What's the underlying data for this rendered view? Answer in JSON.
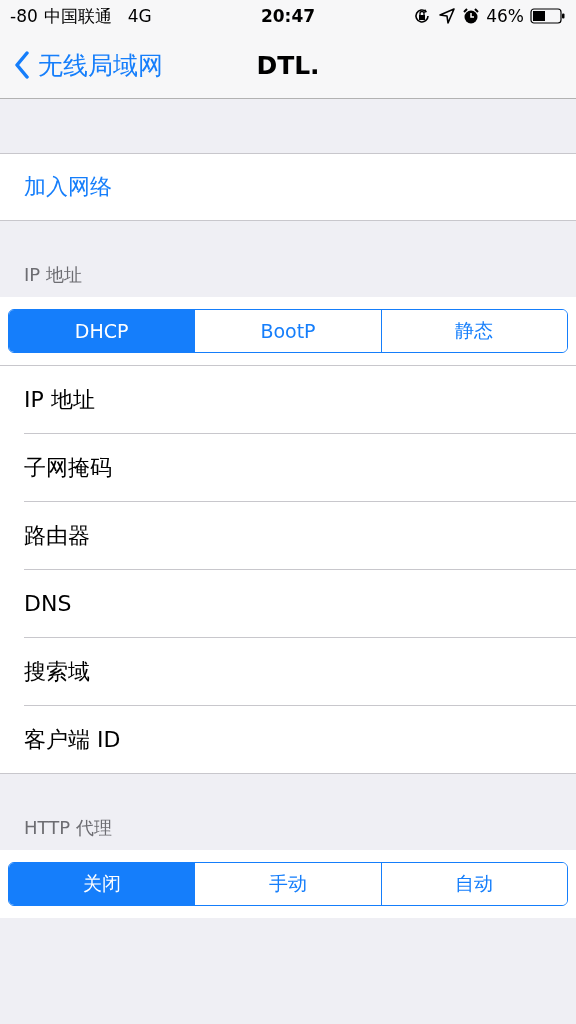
{
  "status_bar": {
    "signal": "-80",
    "carrier": "中国联通",
    "network": "4G",
    "time": "20:47",
    "battery": "46%"
  },
  "nav_bar": {
    "back": "无线局域网",
    "title": "DTL."
  },
  "join_network": "加入网络",
  "ip_section": {
    "header": "IP 地址",
    "segments": [
      {
        "label": "DHCP",
        "selected": true
      },
      {
        "label": "BootP",
        "selected": false
      },
      {
        "label": "静态",
        "selected": false
      }
    ],
    "rows": [
      "IP 地址",
      "子网掩码",
      "路由器",
      "DNS",
      "搜索域",
      "客户端 ID"
    ]
  },
  "proxy_section": {
    "header": "HTTP 代理",
    "segments": [
      {
        "label": "关闭",
        "selected": true
      },
      {
        "label": "手动",
        "selected": false
      },
      {
        "label": "自动",
        "selected": false
      }
    ]
  }
}
